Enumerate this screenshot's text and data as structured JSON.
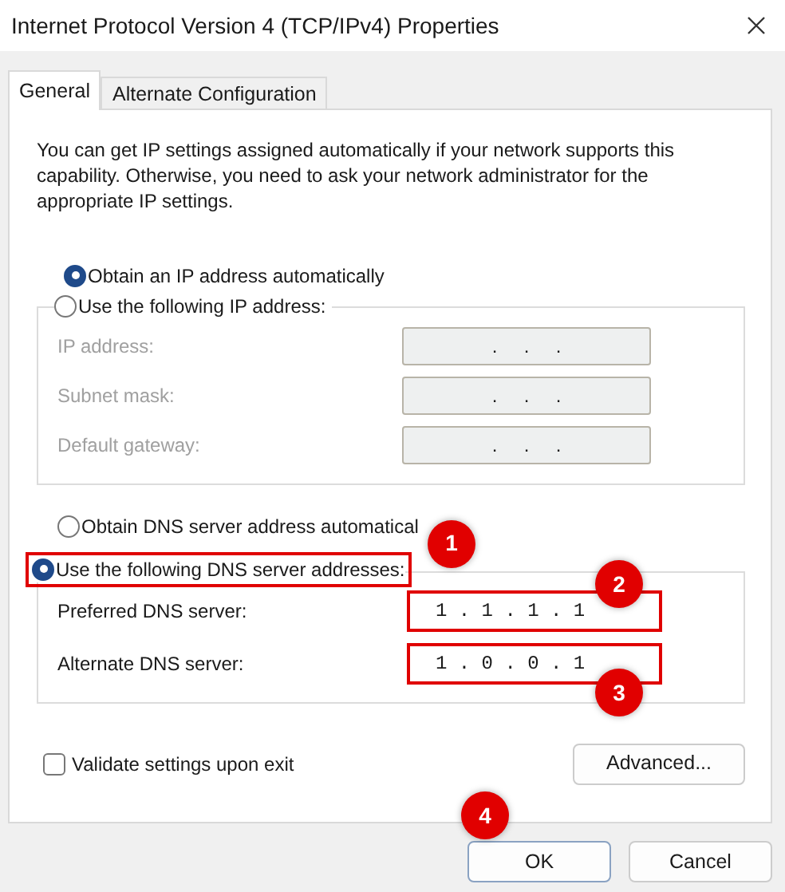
{
  "window": {
    "title": "Internet Protocol Version 4 (TCP/IPv4) Properties"
  },
  "tabs": [
    {
      "label": "General",
      "selected": true
    },
    {
      "label": "Alternate Configuration",
      "selected": false
    }
  ],
  "description": "You can get IP settings assigned automatically if your network supports this capability. Otherwise, you need to ask your network administrator for the appropriate IP settings.",
  "ip_mode": [
    {
      "label": "Obtain an IP address automatically",
      "selected": true
    },
    {
      "label": "Use the following IP address:",
      "selected": false
    }
  ],
  "ip_fields": [
    {
      "label": "IP address:",
      "value": ".     .     .",
      "disabled": true
    },
    {
      "label": "Subnet mask:",
      "value": ".     .     .",
      "disabled": true
    },
    {
      "label": "Default gateway:",
      "value": ".     .     .",
      "disabled": true
    }
  ],
  "dns_mode": [
    {
      "label": "Obtain DNS server address automatical",
      "selected": false,
      "highlighted": false
    },
    {
      "label": "Use the following DNS server addresses:",
      "selected": true,
      "highlighted": true,
      "callout": "1"
    }
  ],
  "dns_fields": [
    {
      "label": "Preferred DNS server:",
      "value": "1 . 1 . 1 . 1",
      "disabled": false,
      "highlighted": true,
      "callout": "2"
    },
    {
      "label": "Alternate DNS server:",
      "value": "1 . 0 . 0 . 1",
      "disabled": false,
      "highlighted": true,
      "callout": "3"
    }
  ],
  "validate": {
    "label": "Validate settings upon exit",
    "checked": false
  },
  "advanced_button": "Advanced...",
  "buttons": [
    {
      "label": "OK",
      "default": true,
      "callout": "4"
    },
    {
      "label": "Cancel",
      "default": false
    }
  ]
}
